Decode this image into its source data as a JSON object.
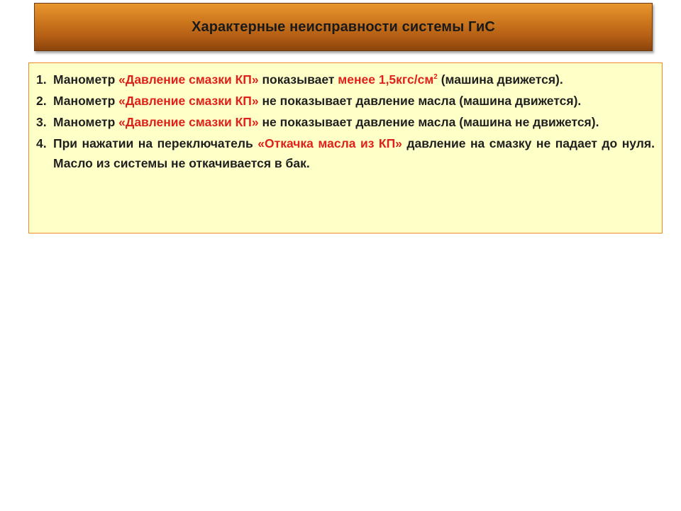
{
  "slide": {
    "title": "Характерные неисправности системы ГиС"
  },
  "faults": [
    {
      "number": "1.",
      "t1": "Манометр ",
      "hl1": "«Давление смазки КП»",
      "t2": " показывает ",
      "hl2": "менее 1,5кгс/см",
      "sup": "2",
      "t3": " (машина движется)."
    },
    {
      "number": "2.",
      "t1": "Манометр ",
      "hl1": "«Давление смазки КП»",
      "t2": " не показывает давление масла (машина движется)."
    },
    {
      "number": "3.",
      "t1": "Манометр ",
      "hl1": "«Давление смазки КП»",
      "t2": " не показывает давление масла (машина не движется)."
    },
    {
      "number": "4.",
      "t1": "При нажатии на переключатель ",
      "hl1": "«Откачка масла из КП»",
      "t2": " давление на смазку не падает до нуля. Масло из системы не откачивается в бак."
    }
  ],
  "colors": {
    "title_banner": "#c06a18",
    "highlight_text": "#e0211b",
    "content_background": "#ffffc8",
    "content_border": "#ee8a2e"
  }
}
